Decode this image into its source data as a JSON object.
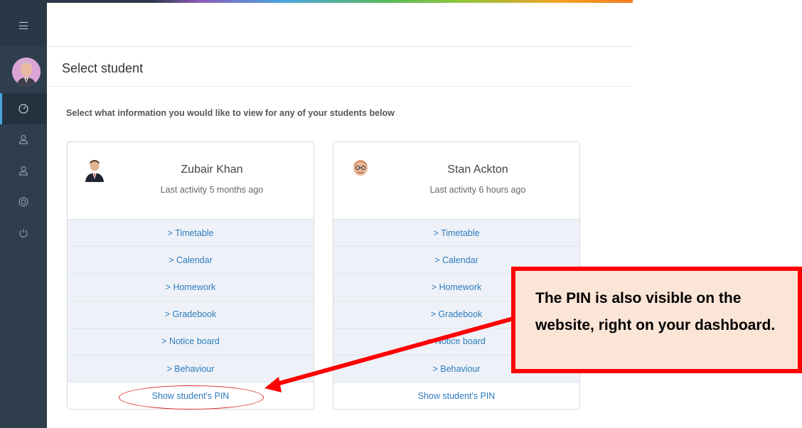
{
  "page": {
    "title": "Select student",
    "instruction": "Select what information you would like to view for any of your students below"
  },
  "sidebar": {
    "icons": [
      "menu-icon",
      "dashboard-icon",
      "user-icon",
      "user-icon",
      "support-icon",
      "power-icon"
    ]
  },
  "students": [
    {
      "name": "Zubair Khan",
      "activity": "Last activity 5 months ago",
      "links": [
        "> Timetable",
        "> Calendar",
        "> Homework",
        "> Gradebook",
        "> Notice board",
        "> Behaviour"
      ],
      "pin_label": "Show student's PIN"
    },
    {
      "name": "Stan Ackton",
      "activity": "Last activity 6 hours ago",
      "links": [
        "> Timetable",
        "> Calendar",
        "> Homework",
        "> Gradebook",
        "> Notice board",
        "> Behaviour"
      ],
      "pin_label": "Show student's PIN"
    }
  ],
  "callout": {
    "text": "The PIN is also visible on the website, right on your dashboard."
  },
  "colors": {
    "sidebar": "#2f3e4d",
    "link": "#2e7bbd",
    "callout_border": "#ff0000",
    "callout_fill": "#fbe5d6"
  }
}
